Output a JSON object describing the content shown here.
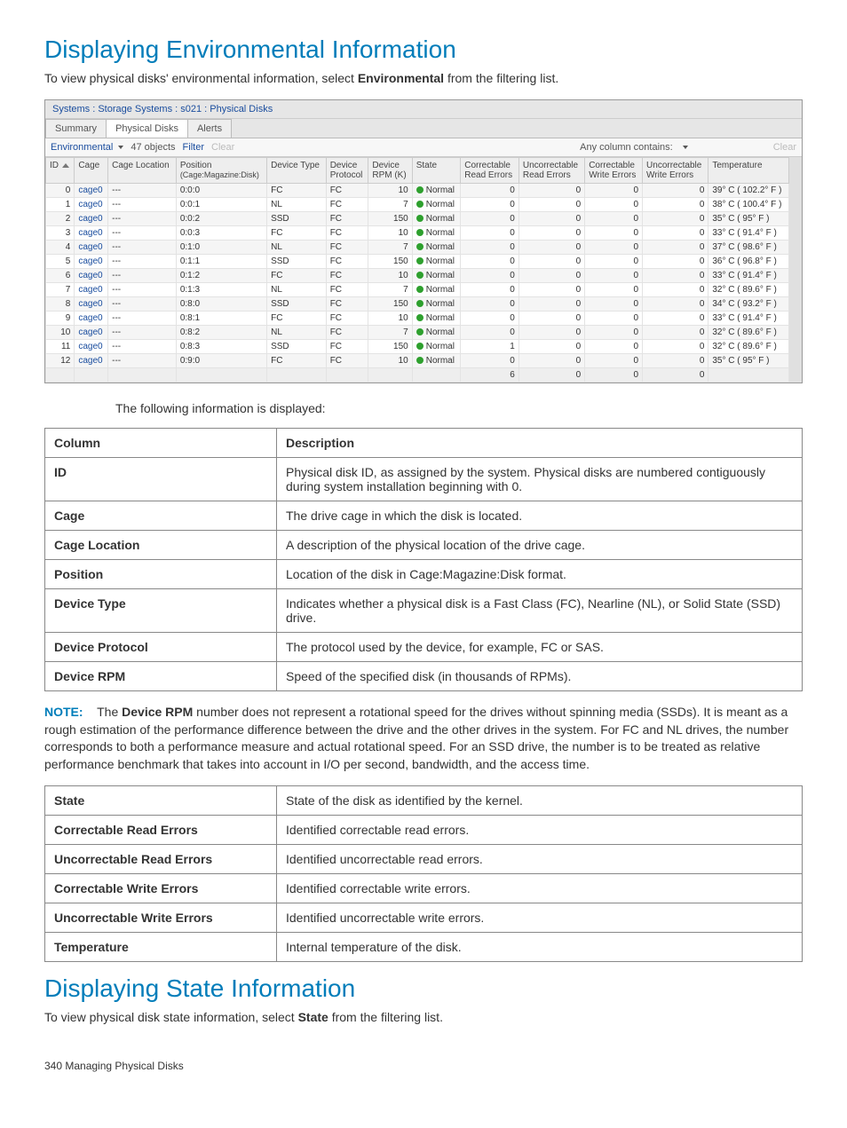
{
  "section1": {
    "title": "Displaying Environmental Information",
    "intro_pre": "To view physical disks' environmental information, select ",
    "intro_strong": "Environmental",
    "intro_post": " from the filtering list."
  },
  "screenshot": {
    "breadcrumb": "Systems : Storage Systems : s021 : Physical Disks",
    "tabs": [
      "Summary",
      "Physical Disks",
      "Alerts"
    ],
    "active_tab": 1,
    "toolbar": {
      "filter_mode": "Environmental",
      "objects": "47 objects",
      "filter": "Filter",
      "clear_left": "Clear",
      "anycol": "Any column contains:",
      "clear_right": "Clear"
    },
    "columns": [
      "ID",
      "Cage",
      "Cage Location",
      "Position\n(Cage:Magazine:Disk)",
      "Device Type",
      "Device Protocol",
      "Device RPM (K)",
      "State",
      "Correctable Read Errors",
      "Uncorrectable Read Errors",
      "Correctable Write Errors",
      "Uncorrectable Write Errors",
      "Temperature"
    ],
    "rows": [
      {
        "id": "0",
        "cage": "cage0",
        "loc": "---",
        "pos": "0:0:0",
        "type": "FC",
        "proto": "FC",
        "rpm": "10",
        "state": "Normal",
        "cre": "0",
        "ure": "0",
        "cwe": "0",
        "uwe": "0",
        "temp": "39° C ( 102.2° F )"
      },
      {
        "id": "1",
        "cage": "cage0",
        "loc": "---",
        "pos": "0:0:1",
        "type": "NL",
        "proto": "FC",
        "rpm": "7",
        "state": "Normal",
        "cre": "0",
        "ure": "0",
        "cwe": "0",
        "uwe": "0",
        "temp": "38° C ( 100.4° F )"
      },
      {
        "id": "2",
        "cage": "cage0",
        "loc": "---",
        "pos": "0:0:2",
        "type": "SSD",
        "proto": "FC",
        "rpm": "150",
        "state": "Normal",
        "cre": "0",
        "ure": "0",
        "cwe": "0",
        "uwe": "0",
        "temp": "35° C ( 95° F )"
      },
      {
        "id": "3",
        "cage": "cage0",
        "loc": "---",
        "pos": "0:0:3",
        "type": "FC",
        "proto": "FC",
        "rpm": "10",
        "state": "Normal",
        "cre": "0",
        "ure": "0",
        "cwe": "0",
        "uwe": "0",
        "temp": "33° C ( 91.4° F )"
      },
      {
        "id": "4",
        "cage": "cage0",
        "loc": "---",
        "pos": "0:1:0",
        "type": "NL",
        "proto": "FC",
        "rpm": "7",
        "state": "Normal",
        "cre": "0",
        "ure": "0",
        "cwe": "0",
        "uwe": "0",
        "temp": "37° C ( 98.6° F )"
      },
      {
        "id": "5",
        "cage": "cage0",
        "loc": "---",
        "pos": "0:1:1",
        "type": "SSD",
        "proto": "FC",
        "rpm": "150",
        "state": "Normal",
        "cre": "0",
        "ure": "0",
        "cwe": "0",
        "uwe": "0",
        "temp": "36° C ( 96.8° F )"
      },
      {
        "id": "6",
        "cage": "cage0",
        "loc": "---",
        "pos": "0:1:2",
        "type": "FC",
        "proto": "FC",
        "rpm": "10",
        "state": "Normal",
        "cre": "0",
        "ure": "0",
        "cwe": "0",
        "uwe": "0",
        "temp": "33° C ( 91.4° F )"
      },
      {
        "id": "7",
        "cage": "cage0",
        "loc": "---",
        "pos": "0:1:3",
        "type": "NL",
        "proto": "FC",
        "rpm": "7",
        "state": "Normal",
        "cre": "0",
        "ure": "0",
        "cwe": "0",
        "uwe": "0",
        "temp": "32° C ( 89.6° F )"
      },
      {
        "id": "8",
        "cage": "cage0",
        "loc": "---",
        "pos": "0:8:0",
        "type": "SSD",
        "proto": "FC",
        "rpm": "150",
        "state": "Normal",
        "cre": "0",
        "ure": "0",
        "cwe": "0",
        "uwe": "0",
        "temp": "34° C ( 93.2° F )"
      },
      {
        "id": "9",
        "cage": "cage0",
        "loc": "---",
        "pos": "0:8:1",
        "type": "FC",
        "proto": "FC",
        "rpm": "10",
        "state": "Normal",
        "cre": "0",
        "ure": "0",
        "cwe": "0",
        "uwe": "0",
        "temp": "33° C ( 91.4° F )"
      },
      {
        "id": "10",
        "cage": "cage0",
        "loc": "---",
        "pos": "0:8:2",
        "type": "NL",
        "proto": "FC",
        "rpm": "7",
        "state": "Normal",
        "cre": "0",
        "ure": "0",
        "cwe": "0",
        "uwe": "0",
        "temp": "32° C ( 89.6° F )"
      },
      {
        "id": "11",
        "cage": "cage0",
        "loc": "---",
        "pos": "0:8:3",
        "type": "SSD",
        "proto": "FC",
        "rpm": "150",
        "state": "Normal",
        "cre": "1",
        "ure": "0",
        "cwe": "0",
        "uwe": "0",
        "temp": "32° C ( 89.6° F )"
      },
      {
        "id": "12",
        "cage": "cage0",
        "loc": "---",
        "pos": "0:9:0",
        "type": "FC",
        "proto": "FC",
        "rpm": "10",
        "state": "Normal",
        "cre": "0",
        "ure": "0",
        "cwe": "0",
        "uwe": "0",
        "temp": "35° C ( 95° F )"
      }
    ],
    "footer": {
      "cre": "6",
      "ure": "0",
      "cwe": "0",
      "uwe": "0"
    }
  },
  "followup": "The following information is displayed:",
  "desc_header": {
    "col": "Column",
    "desc": "Description"
  },
  "desc1": [
    {
      "col": "ID",
      "desc": "Physical disk ID, as assigned by the system. Physical disks are numbered contiguously during system installation beginning with 0."
    },
    {
      "col": "Cage",
      "desc": "The drive cage in which the disk is located."
    },
    {
      "col": "Cage Location",
      "desc": "A description of the physical location of the drive cage."
    },
    {
      "col": "Position",
      "desc": "Location of the disk in Cage:Magazine:Disk format."
    },
    {
      "col": "Device Type",
      "desc": "Indicates whether a physical disk is a Fast Class (FC), Nearline (NL), or Solid State (SSD) drive."
    },
    {
      "col": "Device Protocol",
      "desc": "The protocol used by the device, for example, FC or SAS."
    },
    {
      "col": "Device RPM",
      "desc": "Speed of the specified disk (in thousands of RPMs)."
    }
  ],
  "note": {
    "label": "NOTE:",
    "pre": "The ",
    "strong": "Device RPM",
    "rest": " number does not represent a rotational speed for the drives without spinning media (SSDs). It is meant as a rough estimation of the performance difference between the drive and the other drives in the system. For FC and NL drives, the number corresponds to both a performance measure and actual rotational speed. For an SSD drive, the number is to be treated as relative performance benchmark that takes into account in I/O per second, bandwidth, and the access time."
  },
  "desc2": [
    {
      "col": "State",
      "desc": "State of the disk as identified by the kernel."
    },
    {
      "col": "Correctable Read Errors",
      "desc": "Identified correctable read errors."
    },
    {
      "col": "Uncorrectable Read Errors",
      "desc": "Identified uncorrectable read errors."
    },
    {
      "col": "Correctable Write Errors",
      "desc": "Identified correctable write errors."
    },
    {
      "col": "Uncorrectable Write Errors",
      "desc": "Identified uncorrectable write errors."
    },
    {
      "col": "Temperature",
      "desc": "Internal temperature of the disk."
    }
  ],
  "section2": {
    "title": "Displaying State Information",
    "intro_pre": "To view physical disk state information, select ",
    "intro_strong": "State",
    "intro_post": " from the filtering list."
  },
  "footer": "340   Managing Physical Disks"
}
